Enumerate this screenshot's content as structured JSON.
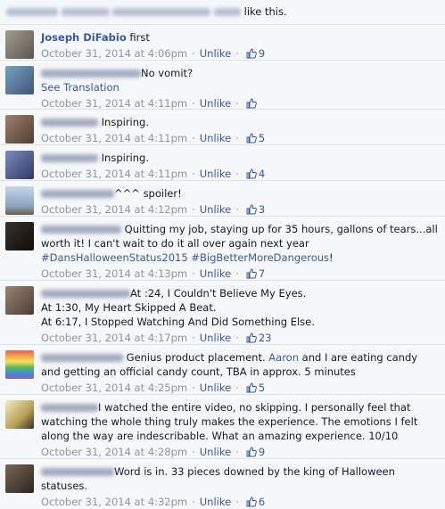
{
  "header": {
    "suffix": "like this."
  },
  "colors": {
    "link": "#3b5998",
    "meta": "#90949c",
    "text": "#141823"
  },
  "comments": [
    {
      "author": "Joseph DiFabio",
      "blurred": false,
      "text": "first",
      "time": "October 31, 2014 at 4:06pm",
      "action": "Unlike",
      "likes": "9",
      "avatar": "#7d7a71"
    },
    {
      "author": "",
      "blurred": true,
      "text": "No vomit?",
      "extra": "See Translation",
      "time": "October 31, 2014 at 4:11pm",
      "action": "Unlike",
      "likes": "",
      "avatar": "#5d7a97"
    },
    {
      "author": "",
      "blurred": true,
      "text": "Inspiring.",
      "time": "October 31, 2014 at 4:11pm",
      "action": "Unlike",
      "likes": "5",
      "avatar": "#7a5e50"
    },
    {
      "author": "",
      "blurred": true,
      "text": "Inspiring.",
      "time": "October 31, 2014 at 4:11pm",
      "action": "Unlike",
      "likes": "4",
      "avatar": "#4e5a85"
    },
    {
      "author": "",
      "blurred": true,
      "text": "^^^ spoiler!",
      "time": "October 31, 2014 at 4:12pm",
      "action": "Unlike",
      "likes": "3",
      "avatar": "#9eb7cf"
    },
    {
      "author": "",
      "blurred": true,
      "text_parts": [
        "Quitting my job, staying up for 35 hours, gallons of tears...all worth it! I can't wait to do it all over again next year ",
        "#DansHalloweenStatus2015",
        " ",
        "#BigBetterMoreDangerous",
        "!"
      ],
      "time": "October 31, 2014 at 4:13pm",
      "action": "Unlike",
      "likes": "7",
      "avatar": "#2a2522"
    },
    {
      "author": "",
      "blurred": true,
      "lines": [
        "At :24, I Couldn't Believe My Eyes.",
        "At 1:30, My Heart Skipped A Beat.",
        "At 6:17, I Stopped Watching And Did Something Else."
      ],
      "time": "October 31, 2014 at 4:17pm",
      "action": "Unlike",
      "likes": "23",
      "avatar": "#6d5b4e"
    },
    {
      "author": "",
      "blurred": true,
      "text_parts": [
        "Genius product placement. ",
        "Aaron",
        " and I are eating candy and getting an official candy count, TBA in approx. 5 minutes"
      ],
      "time": "October 31, 2014 at 4:25pm",
      "action": "Unlike",
      "likes": "5",
      "avatar": "#c26b8e"
    },
    {
      "author": "",
      "blurred": true,
      "text": "I watched the entire video, no skipping. I personally feel that watching the whole thing truly makes the experience. The emotions I felt along the way are indescribable. What an amazing experience. 10/10",
      "time": "October 31, 2014 at 4:28pm",
      "action": "Unlike",
      "likes": "9",
      "avatar": "#d7c98a"
    },
    {
      "author": "",
      "blurred": true,
      "text": "Word is in. 33 pieces downed by the king of Halloween statuses.",
      "time": "October 31, 2014 at 4:32pm",
      "action": "Unlike",
      "likes": "6",
      "avatar": "#5b4a3f"
    }
  ]
}
